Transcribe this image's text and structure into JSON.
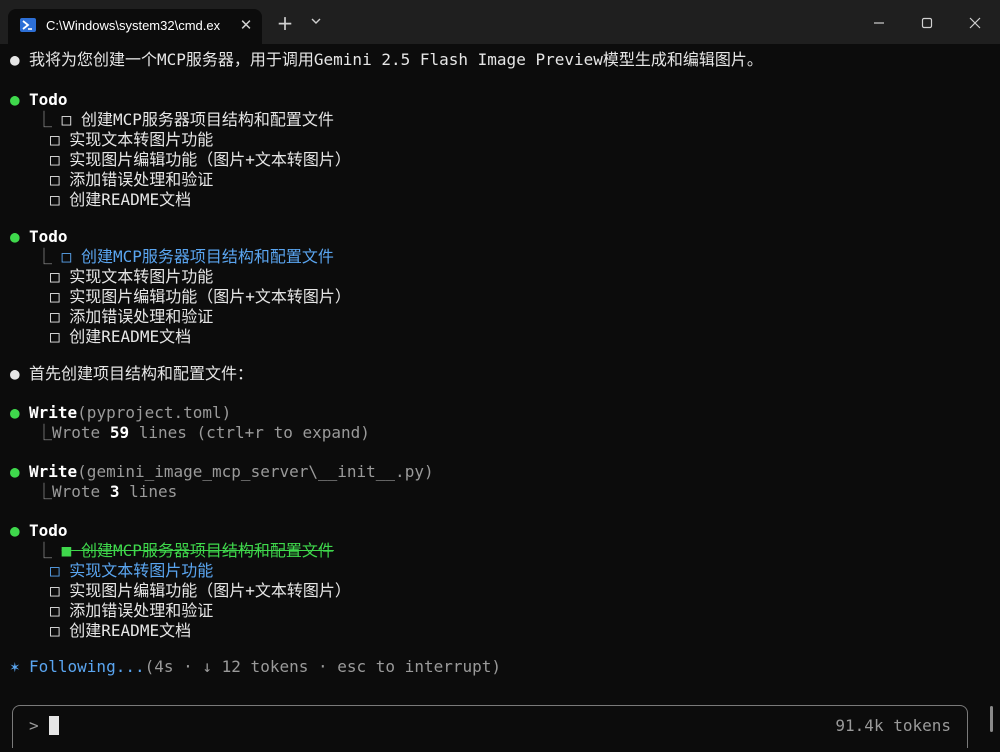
{
  "window": {
    "tab_title": "C:\\Windows\\system32\\cmd.ex",
    "tab_close": "✕",
    "new_tab": "+",
    "dropdown": "⌄"
  },
  "colors": {
    "background": "#0c0c0c",
    "green_bullet": "#3fd84c",
    "highlight_blue": "#5aa5f0",
    "dim_text": "#9a9a9a"
  },
  "console": {
    "intro": "我将为您创建一个MCP服务器，用于调用Gemini 2.5 Flash Image Preview模型生成和编辑图片。",
    "todo1": {
      "title": "Todo",
      "items": [
        "创建MCP服务器项目结构和配置文件",
        "实现文本转图片功能",
        "实现图片编辑功能（图片+文本转图片）",
        "添加错误处理和验证",
        "创建README文档"
      ]
    },
    "todo2": {
      "title": "Todo",
      "items": [
        "创建MCP服务器项目结构和配置文件",
        "实现文本转图片功能",
        "实现图片编辑功能（图片+文本转图片）",
        "添加错误处理和验证",
        "创建README文档"
      ]
    },
    "first_msg": "首先创建项目结构和配置文件：",
    "write1": {
      "label": "Write",
      "arg": "(pyproject.toml)",
      "result_pre": "Wrote ",
      "result_num": "59",
      "result_post": " lines (ctrl+r to expand)"
    },
    "write2": {
      "label": "Write",
      "arg": "(gemini_image_mcp_server\\__init__.py)",
      "result_pre": "Wrote ",
      "result_num": "3",
      "result_post": " lines"
    },
    "todo3": {
      "title": "Todo",
      "items": [
        "创建MCP服务器项目结构和配置文件",
        "实现文本转图片功能",
        "实现图片编辑功能（图片+文本转图片）",
        "添加错误处理和验证",
        "创建README文档"
      ]
    },
    "status": {
      "star": "✶",
      "word": "Following...",
      "detail": "(4s · ↓ 12 tokens · esc to interrupt)"
    }
  },
  "input": {
    "prompt": ">",
    "tokens": "91.4k tokens"
  },
  "glyphs": {
    "bullet": "●",
    "box_empty": "□",
    "box_done": "■",
    "tree": "⎿"
  }
}
